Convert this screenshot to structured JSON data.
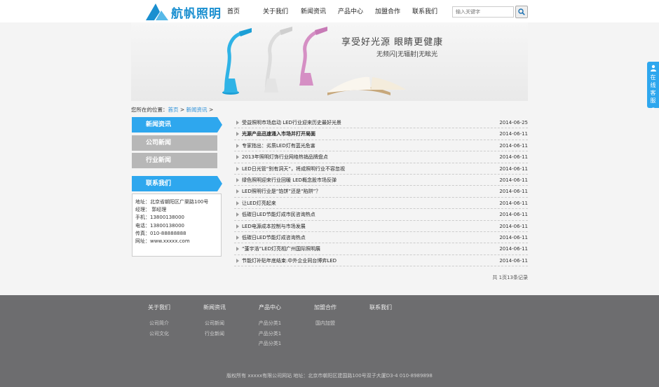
{
  "brand": {
    "name": "航帆照明",
    "color": "#1a8fd0"
  },
  "nav": {
    "items": [
      {
        "label": "首页"
      },
      {
        "label": "关于我们"
      },
      {
        "label": "新闻资讯"
      },
      {
        "label": "产品中心"
      },
      {
        "label": "加盟合作"
      },
      {
        "label": "联系我们"
      }
    ]
  },
  "search": {
    "placeholder": "输入关键字",
    "icon": "search-icon"
  },
  "banner": {
    "title": "享受好光源 眼睛更健康",
    "subtitle": "无频闪|无辐射|无眩光"
  },
  "breadcrumb": {
    "prefix": "您所在的位置：",
    "home": "首页",
    "sep": " > ",
    "current": "新闻资讯",
    "tail": " >"
  },
  "sidebar": {
    "tabs": [
      {
        "label": "新闻资讯"
      },
      {
        "label": "公司新闻"
      },
      {
        "label": "行业新闻"
      }
    ],
    "contact_title": "联系我们",
    "contact": [
      "地址：北京省朝阳区广渠路100号",
      "经理：  郭经理",
      "手机：13800138000",
      "电话：13800138000",
      "传真：010-88888888",
      "网址：www.xxxxx.com"
    ]
  },
  "news": [
    {
      "title": "受益照明市场启动 LED行业迎来历史最好光景",
      "date": "2014-06-25",
      "bold": false
    },
    {
      "title": "光源产品迅速涌入市场并打开局面",
      "date": "2014-06-11",
      "bold": true
    },
    {
      "title": "专家指出：劣质LED灯有蓝光危害",
      "date": "2014-06-11",
      "bold": false
    },
    {
      "title": "2013年照明灯饰行业网络热销品牌盘点",
      "date": "2014-06-11",
      "bold": false
    },
    {
      "title": "LED日光管“别有洞天”，将成照明行业不容忽视",
      "date": "2014-06-11",
      "bold": false
    },
    {
      "title": "绿色照明迎来行业回暖 LED概念股市场反弹",
      "date": "2014-06-11",
      "bold": false
    },
    {
      "title": "LED照明行业是“馅饼”还是“陷阱”？",
      "date": "2014-06-11",
      "bold": false
    },
    {
      "title": "让LED灯亮起来",
      "date": "2014-06-11",
      "bold": false
    },
    {
      "title": "低碳日LED节能灯成市民咨询热点",
      "date": "2014-06-11",
      "bold": false
    },
    {
      "title": "LED电源成本控制与市场发展",
      "date": "2014-06-11",
      "bold": false
    },
    {
      "title": "低碳日LED节能灯成咨询热点",
      "date": "2014-06-11",
      "bold": false
    },
    {
      "title": "“蓬宇浩”LED灯亮相广州国际照明展",
      "date": "2014-06-11",
      "bold": false
    },
    {
      "title": "节能灯补贴年底结束:中外企业同台博弈LED",
      "date": "2014-06-11",
      "bold": false
    }
  ],
  "paging": {
    "text": "共 1页13条记录"
  },
  "footer": {
    "cols": [
      {
        "head": "关于我们",
        "links": [
          "公司简介",
          "公司文化"
        ]
      },
      {
        "head": "新闻资讯",
        "links": [
          "公司新闻",
          "行业新闻"
        ]
      },
      {
        "head": "产品中心",
        "links": [
          "产品分类1",
          "产品分类1",
          "产品分类1"
        ]
      },
      {
        "head": "加盟合作",
        "links": [
          "国内加盟"
        ]
      },
      {
        "head": "联系我们",
        "links": []
      }
    ],
    "copyright": "版权所有 xxxxx有限公司网站 地址：北京市朝阳区建国路100号双子大厦D3-4 010-8989898"
  },
  "chat": {
    "label": "在线客服",
    "icon": "chevron-left-icon"
  },
  "colors": {
    "accent": "#2ea7ee",
    "footer": "#6d6d6f"
  }
}
